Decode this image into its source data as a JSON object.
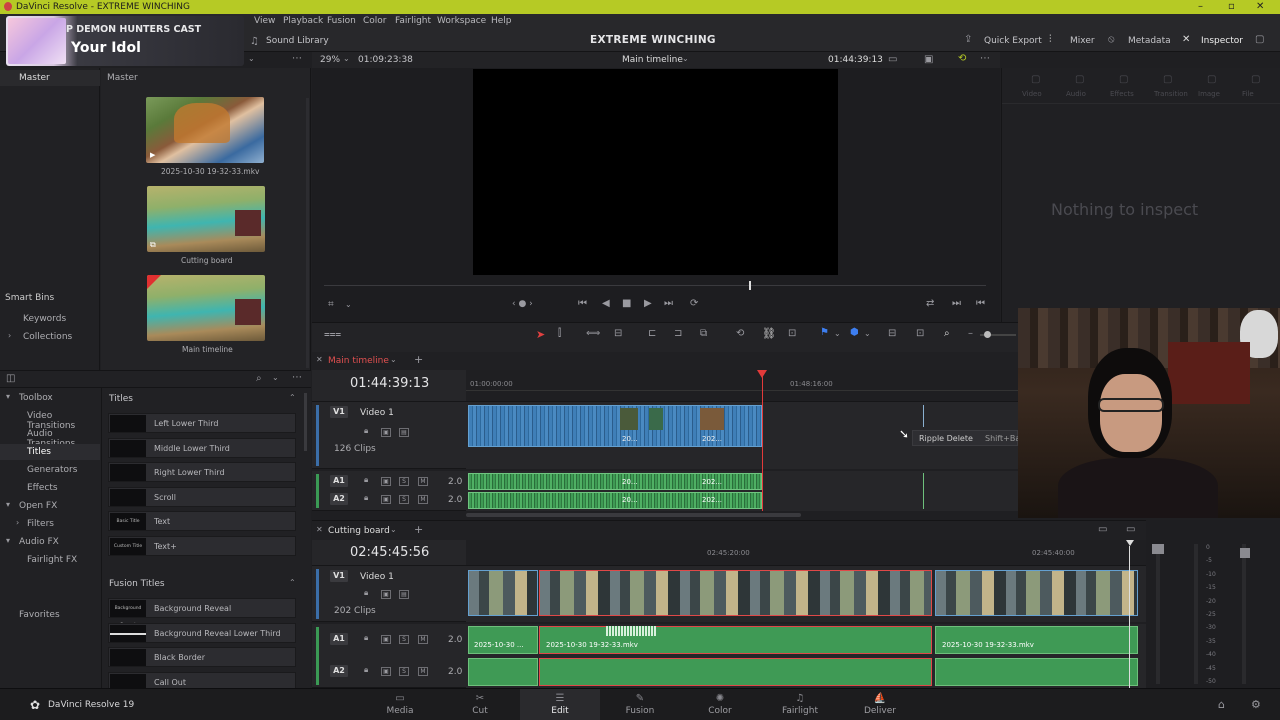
{
  "window": {
    "title": "DaVinci Resolve - EXTREME WINCHING"
  },
  "menu": [
    "View",
    "Playback",
    "Fusion",
    "Color",
    "Fairlight",
    "Workspace",
    "Help"
  ],
  "overlay": {
    "line1": "P DEMON HUNTERS CAST",
    "line2": "Your Idol"
  },
  "toolbar": {
    "sound_library": "Sound Library",
    "project_title": "EXTREME WINCHING",
    "quick_export": "Quick Export",
    "mixer": "Mixer",
    "metadata": "Metadata",
    "inspector": "Inspector"
  },
  "viewer": {
    "zoom": "29%",
    "timecode_left": "01:09:23:38",
    "timeline_name": "Main timeline",
    "timecode_right": "01:44:39:13"
  },
  "media_pool": {
    "bin_master_left": "Master",
    "bin_master_right": "Master",
    "smart_bins": "Smart Bins",
    "keywords": "Keywords",
    "collections": "Collections",
    "clips": [
      {
        "name": "2025-10-30 19-32-33.mkv"
      },
      {
        "name": "Cutting board"
      },
      {
        "name": "Main timeline"
      }
    ]
  },
  "inspector": {
    "tabs": [
      "Video",
      "Audio",
      "Effects",
      "Transition",
      "Image",
      "File"
    ],
    "empty": "Nothing to inspect"
  },
  "effects": {
    "tree": [
      {
        "label": "Toolbox",
        "level": 0,
        "arrow": "▾"
      },
      {
        "label": "Video Transitions",
        "level": 1
      },
      {
        "label": "Audio Transitions",
        "level": 1
      },
      {
        "label": "Titles",
        "level": 1,
        "selected": true
      },
      {
        "label": "Generators",
        "level": 1
      },
      {
        "label": "Effects",
        "level": 1
      },
      {
        "label": "Open FX",
        "level": 0,
        "arrow": "▾"
      },
      {
        "label": "Filters",
        "level": 1,
        "arrow": "›"
      },
      {
        "label": "Audio FX",
        "level": 0,
        "arrow": "▾"
      },
      {
        "label": "Fairlight FX",
        "level": 1
      }
    ],
    "favorites": "Favorites",
    "titles_header": "Titles",
    "titles": [
      {
        "name": "Left Lower Third",
        "preview": ""
      },
      {
        "name": "Middle Lower Third",
        "preview": ""
      },
      {
        "name": "Right Lower Third",
        "preview": ""
      },
      {
        "name": "Scroll",
        "preview": ""
      },
      {
        "name": "Text",
        "preview": "Basic Title"
      },
      {
        "name": "Text+",
        "preview": "Custom Title"
      }
    ],
    "fusion_header": "Fusion Titles",
    "fusion_titles": [
      {
        "name": "Background Reveal",
        "preview": "Background Reveal"
      },
      {
        "name": "Background Reveal Lower Third",
        "preview": ""
      },
      {
        "name": "Black Border",
        "preview": ""
      },
      {
        "name": "Call Out",
        "preview": ""
      }
    ]
  },
  "main_timeline": {
    "tab": "Main timeline",
    "timecode": "01:44:39:13",
    "ruler": [
      "01:00:00:00",
      "01:48:16:00"
    ],
    "v1": {
      "tag": "V1",
      "name": "Video 1",
      "clips": "126 Clips"
    },
    "a1": {
      "tag": "A1",
      "level": "2.0"
    },
    "a2": {
      "tag": "A2",
      "level": "2.0"
    },
    "clip_labels": [
      "20...",
      "202...",
      "20...",
      "202...",
      "20...",
      "202..."
    ],
    "tooltip": {
      "label": "Ripple Delete",
      "shortcut": "Shift+Ba"
    }
  },
  "cutting_board": {
    "tab": "Cutting board",
    "timecode": "02:45:45:56",
    "ruler": [
      "02:45:20:00",
      "02:45:40:00"
    ],
    "v1": {
      "tag": "V1",
      "name": "Video 1",
      "clips": "202 Clips"
    },
    "a1": {
      "tag": "A1",
      "level": "2.0"
    },
    "a2": {
      "tag": "A2",
      "level": "2.0"
    },
    "audio_labels": [
      "2025-10-30 ...",
      "2025-10-30 19-32-33.mkv",
      "2025-10-30 19-32-33.mkv"
    ]
  },
  "meters": [
    "0",
    "-5",
    "-10",
    "-15",
    "-20",
    "-25",
    "-30",
    "-35",
    "-40",
    "-45",
    "-50"
  ],
  "pagebar": {
    "brand": "DaVinci Resolve 19",
    "pages": [
      {
        "label": "Media",
        "icon": "▭"
      },
      {
        "label": "Cut",
        "icon": "✂"
      },
      {
        "label": "Edit",
        "icon": "☰",
        "active": true
      },
      {
        "label": "Fusion",
        "icon": "✎"
      },
      {
        "label": "Color",
        "icon": "✺"
      },
      {
        "label": "Fairlight",
        "icon": "♫"
      },
      {
        "label": "Deliver",
        "icon": "⛵"
      }
    ]
  }
}
